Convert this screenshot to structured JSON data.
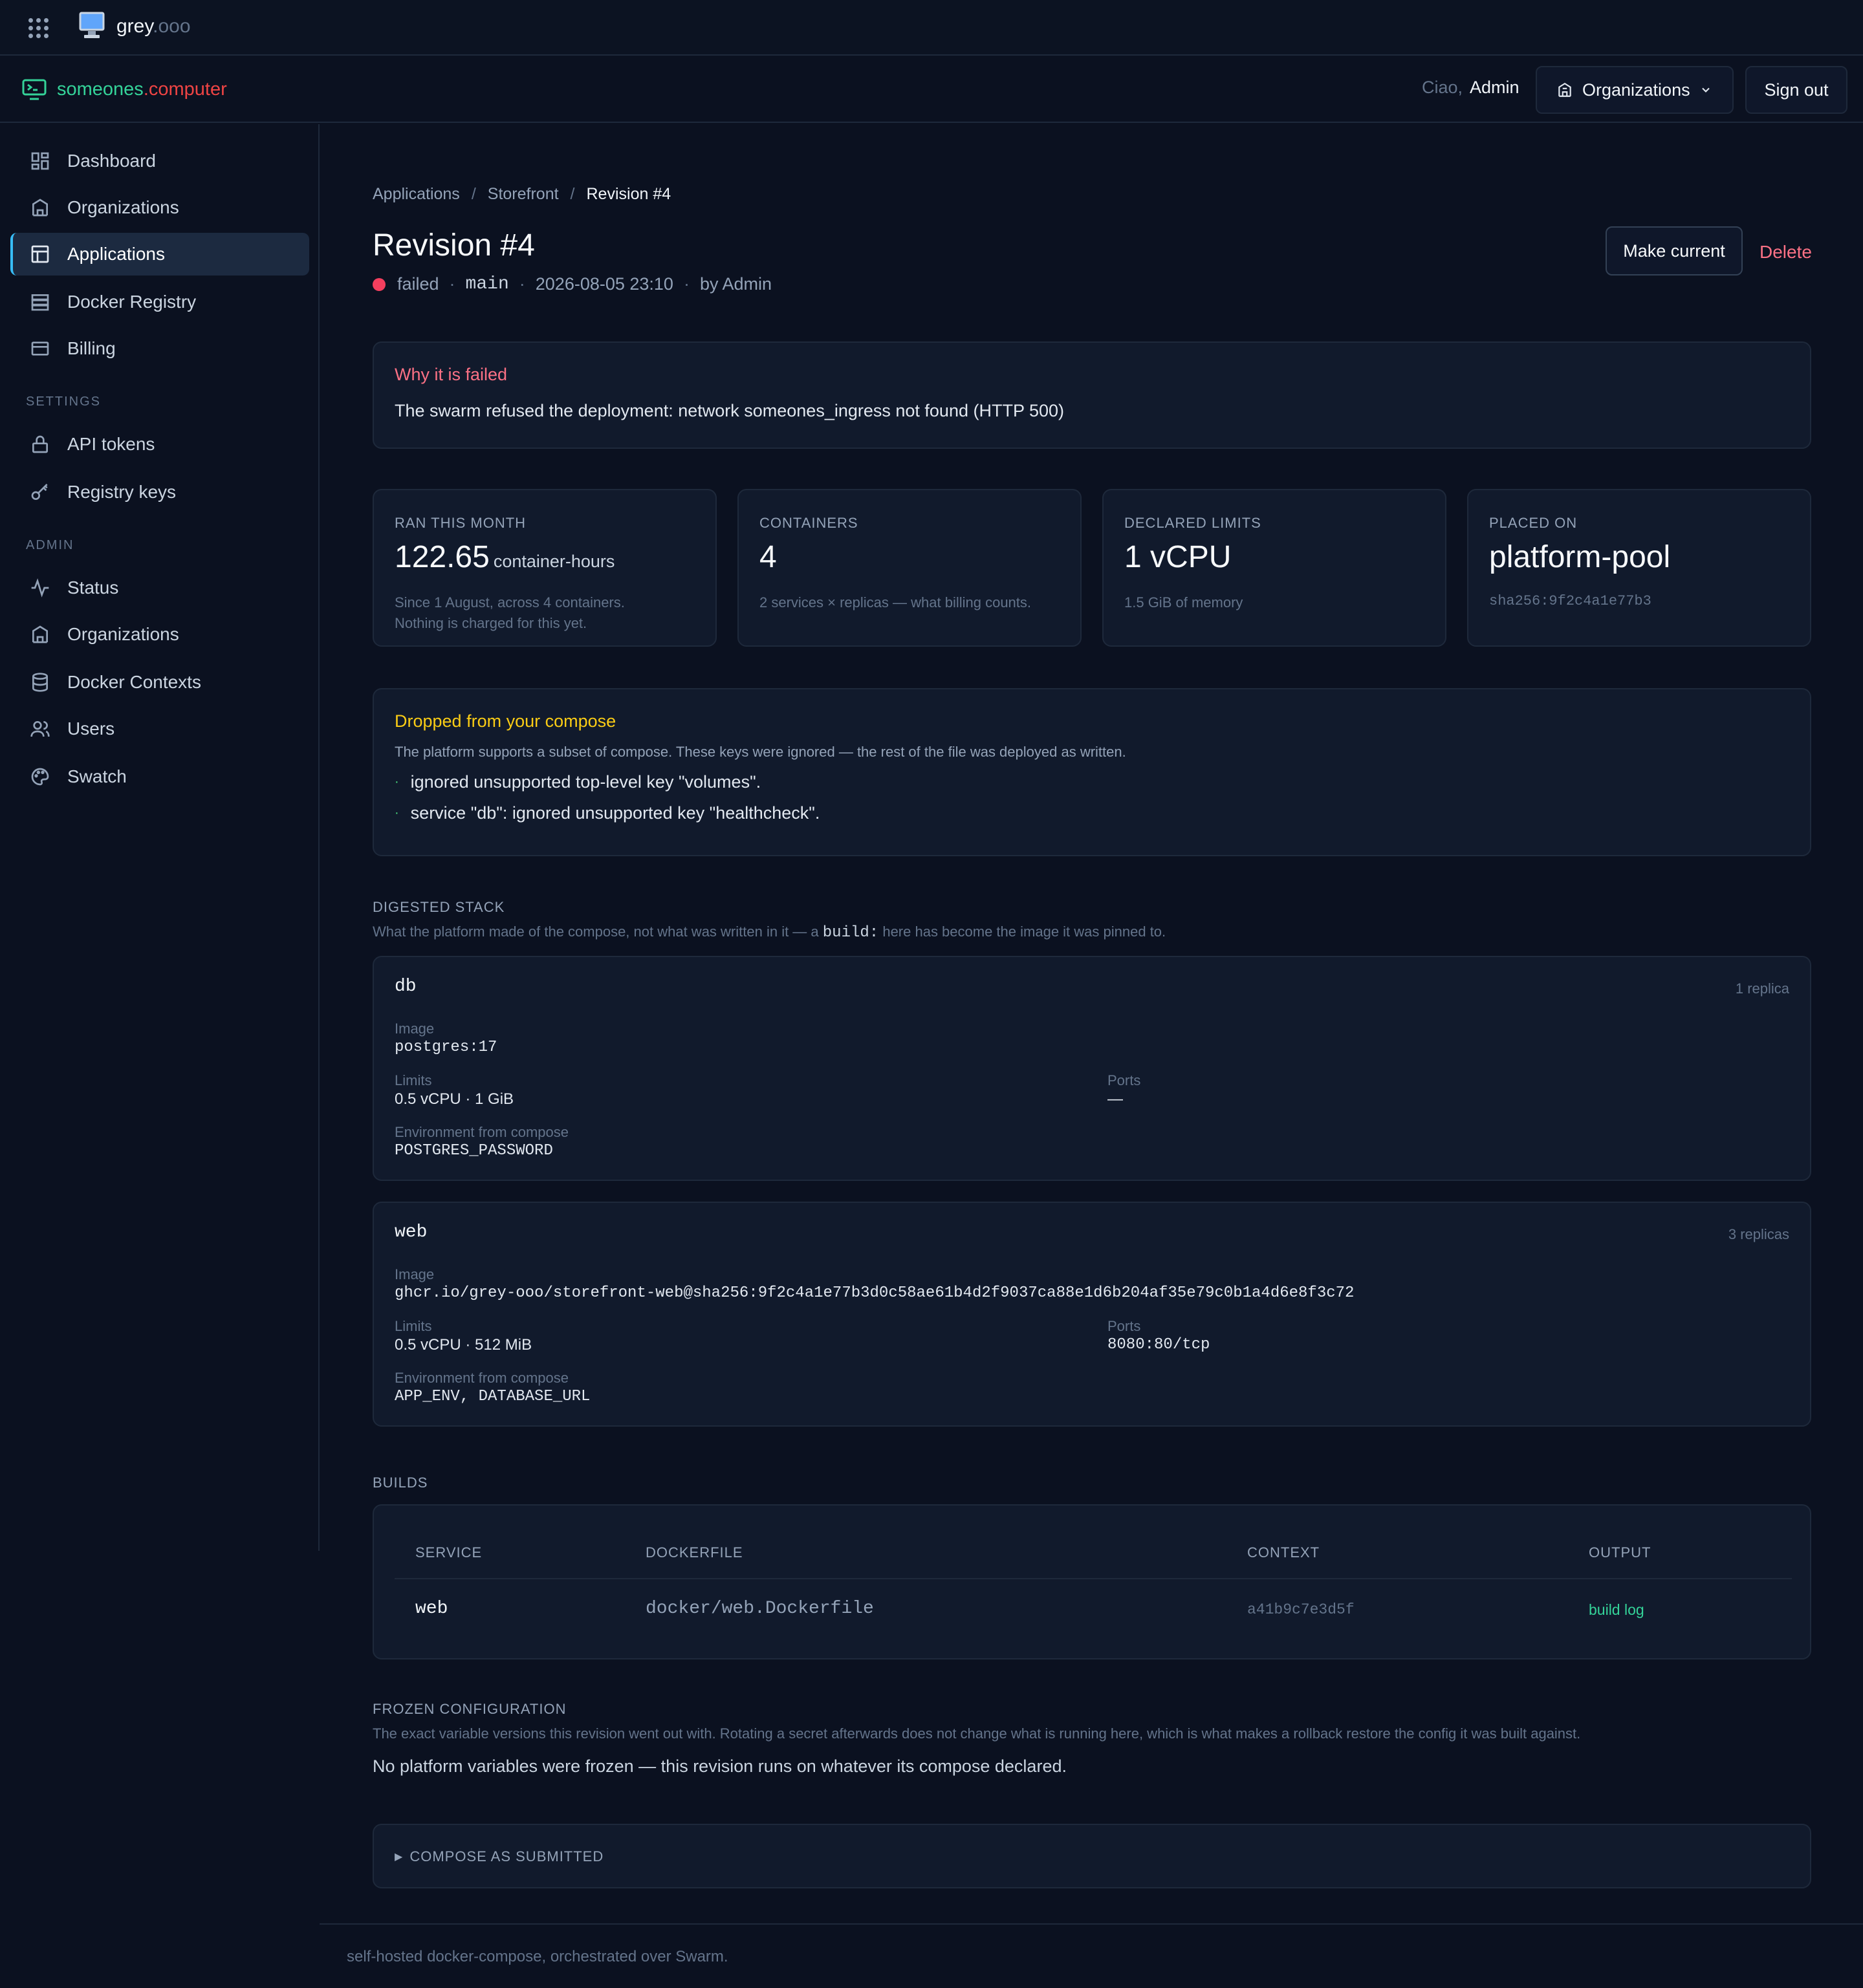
{
  "topbar": {
    "brand_main": "grey",
    "brand_suffix": ".ooo"
  },
  "header": {
    "brand_a": "someones",
    "brand_b": ".computer",
    "greeting": "Ciao,",
    "user": "Admin",
    "org_button": "Organizations",
    "signout": "Sign out"
  },
  "sidebar": {
    "items": [
      {
        "label": "Dashboard",
        "icon": "dashboard-icon"
      },
      {
        "label": "Organizations",
        "icon": "building-icon"
      },
      {
        "label": "Applications",
        "icon": "layout-icon",
        "active": true
      },
      {
        "label": "Docker Registry",
        "icon": "server-icon"
      },
      {
        "label": "Billing",
        "icon": "credit-card-icon"
      }
    ],
    "settings_label": "SETTINGS",
    "settings_items": [
      {
        "label": "API tokens",
        "icon": "lock-icon"
      },
      {
        "label": "Registry keys",
        "icon": "key-icon"
      }
    ],
    "admin_label": "ADMIN",
    "admin_items": [
      {
        "label": "Status",
        "icon": "activity-icon"
      },
      {
        "label": "Organizations",
        "icon": "building-icon"
      },
      {
        "label": "Docker Contexts",
        "icon": "database-icon"
      },
      {
        "label": "Users",
        "icon": "users-icon"
      },
      {
        "label": "Swatch",
        "icon": "palette-icon"
      }
    ]
  },
  "breadcrumb": {
    "items": [
      "Applications",
      "Storefront",
      "Revision #4"
    ],
    "separator": "/"
  },
  "revision": {
    "title": "Revision #4",
    "status": "failed",
    "status_color": "#f43f5e",
    "branch": "main",
    "timestamp": "2026-08-05 23:10",
    "author": "by Admin",
    "make_current": "Make current",
    "delete": "Delete"
  },
  "failure": {
    "title": "Why it is failed",
    "message": "The swarm refused the deployment: network someones_ingress not found (HTTP 500)"
  },
  "stats": [
    {
      "label": "RAN THIS MONTH",
      "value": "122.65",
      "unit": "container-hours",
      "sub1": "Since 1 August, across 4 containers.",
      "sub2": "Nothing is charged for this yet."
    },
    {
      "label": "CONTAINERS",
      "value": "4",
      "sub1": "2 services × replicas — what billing counts."
    },
    {
      "label": "DECLARED LIMITS",
      "value": "1 vCPU",
      "sub1": "1.5 GiB of memory"
    },
    {
      "label": "PLACED ON",
      "value": "platform-pool",
      "sub1": "sha256:9f2c4a1e77b3"
    }
  ],
  "dropped": {
    "title": "Dropped from your compose",
    "desc": "The platform supports a subset of compose. These keys were ignored — the rest of the file was deployed as written.",
    "items": [
      "ignored unsupported top-level key \"volumes\".",
      "service \"db\": ignored unsupported key \"healthcheck\"."
    ]
  },
  "digested": {
    "label": "DIGESTED STACK",
    "desc_pre": "What the platform made of the compose, not what was written in it — a",
    "desc_code": "build:",
    "desc_post": "here has become the image it was pinned to.",
    "image_label": "Image",
    "limits_label": "Limits",
    "ports_label": "Ports",
    "env_label": "Environment from compose",
    "services": [
      {
        "name": "db",
        "replicas": "1 replica",
        "image": "postgres:17",
        "limits": "0.5 vCPU · 1 GiB",
        "ports": "—",
        "env": "POSTGRES_PASSWORD"
      },
      {
        "name": "web",
        "replicas": "3 replicas",
        "image": "ghcr.io/grey-ooo/storefront-web@sha256:9f2c4a1e77b3d0c58ae61b4d2f9037ca88e1d6b204af35e79c0b1a4d6e8f3c72",
        "limits": "0.5 vCPU · 512 MiB",
        "ports": "8080:80/tcp",
        "env": "APP_ENV, DATABASE_URL"
      }
    ]
  },
  "builds": {
    "label": "BUILDS",
    "columns": [
      "SERVICE",
      "DOCKERFILE",
      "CONTEXT",
      "OUTPUT"
    ],
    "rows": [
      {
        "service": "web",
        "dockerfile": "docker/web.Dockerfile",
        "context": "a41b9c7e3d5f",
        "output": "build log"
      }
    ]
  },
  "frozen": {
    "label": "FROZEN CONFIGURATION",
    "desc": "The exact variable versions this revision went out with. Rotating a secret afterwards does not change what is running here, which is what makes a rollback restore the config it was built against.",
    "message": "No platform variables were frozen — this revision runs on whatever its compose declared."
  },
  "compose": {
    "toggle": "COMPOSE AS SUBMITTED"
  },
  "footer": {
    "text": "self-hosted docker-compose, orchestrated over Swarm."
  },
  "colors": {
    "accent_green": "#34d399",
    "accent_red": "#ef4444",
    "warning": "#facc15",
    "danger": "#fb7185"
  }
}
